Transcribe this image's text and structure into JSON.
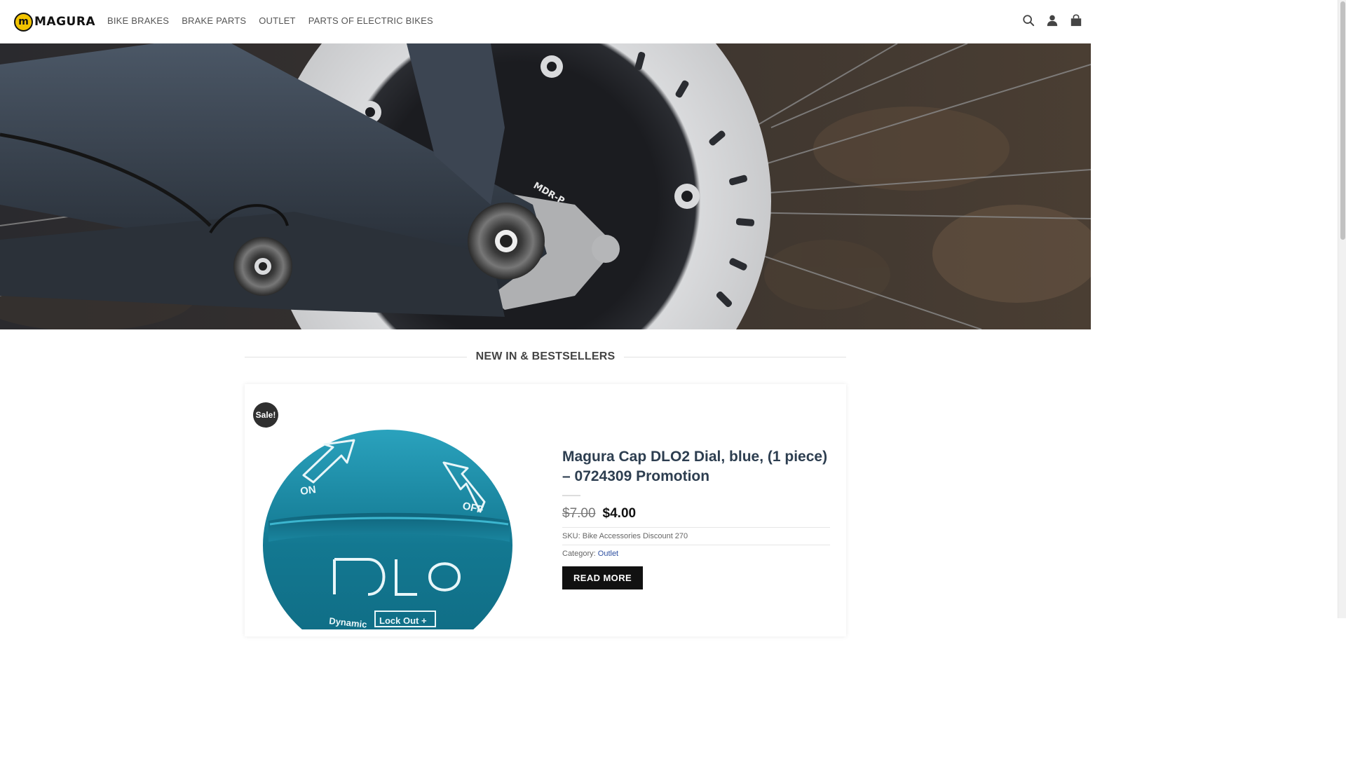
{
  "brand": {
    "logo_mark": "m",
    "logo_text": "MAGURA"
  },
  "nav": {
    "items": [
      {
        "label": "BIKE BRAKES"
      },
      {
        "label": "BRAKE PARTS"
      },
      {
        "label": "OUTLET"
      },
      {
        "label": "PARTS OF ELECTRIC BIKES"
      }
    ]
  },
  "header_icons": [
    "search-icon",
    "account-icon",
    "cart-icon"
  ],
  "hero": {
    "image_subject": "bike-frame-and-brake-rotor-photo",
    "rotor_text": "MDR-P"
  },
  "section": {
    "title": "NEW IN & BESTSELLERS"
  },
  "product": {
    "badge": "Sale!",
    "image_subject": "blue-dlo2-dial-cap",
    "image_text": {
      "on": "ON",
      "off": "OFF",
      "dynamic": "Dynamic",
      "lockout": "Lock Out +"
    },
    "title": "Magura Cap DLO2 Dial, blue, (1 piece) – 0724309 Promotion",
    "price_old": "$7.00",
    "price_new": "$4.00",
    "sku_label": "SKU:",
    "sku_value": "Bike Accessories Discount 270",
    "category_label": "Category:",
    "category_value": "Outlet",
    "button_label": "READ MORE"
  },
  "colors": {
    "brand_yellow": "#f2c400",
    "title_blue": "#2d3e50",
    "link_blue": "#2d4fa0",
    "product_teal": "#1b7e96",
    "button_black": "#111111"
  }
}
